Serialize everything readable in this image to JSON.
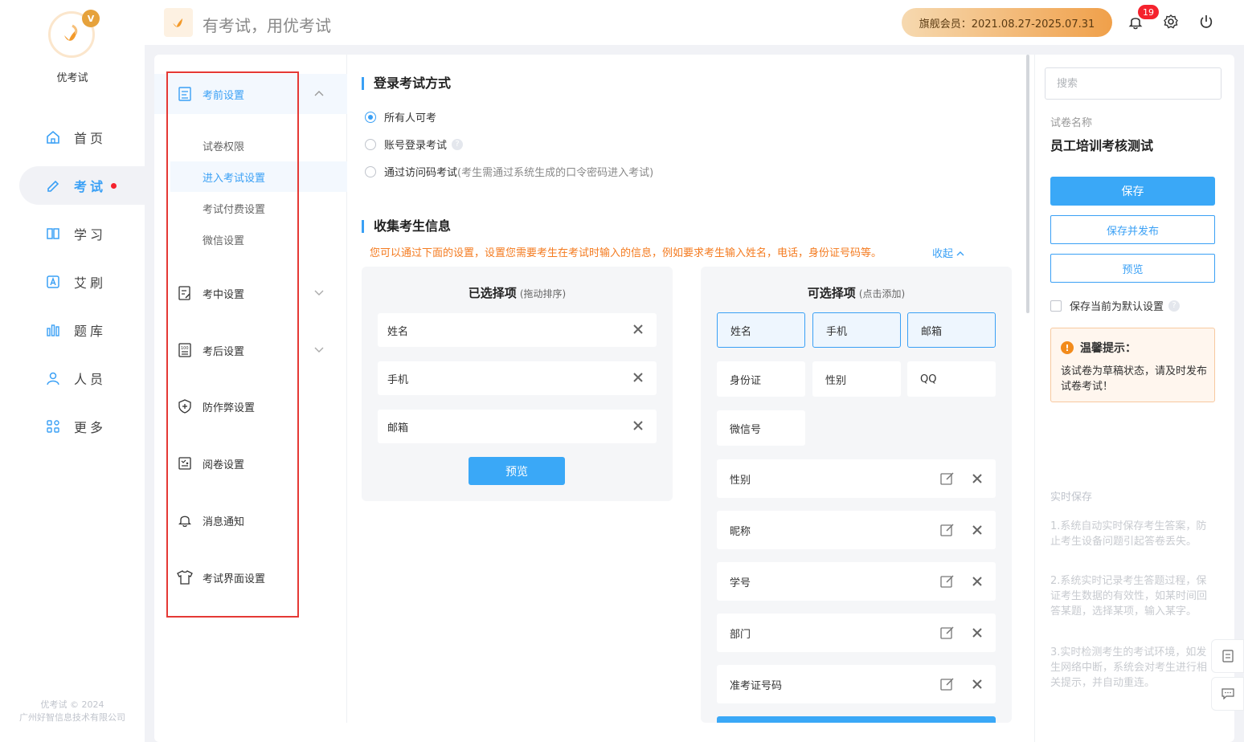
{
  "app": {
    "logo_text": "优考试",
    "logo_badge": "V",
    "slogan": "有考试，用优考试",
    "copyright_line1": "优考试 © 2024",
    "copyright_line2": "广州好智信息技术有限公司",
    "accent_color": "#3aa0f5"
  },
  "nav": {
    "items": [
      {
        "label": "首页",
        "icon": "home-icon"
      },
      {
        "label": "考试",
        "icon": "pencil-icon",
        "active": true
      },
      {
        "label": "学习",
        "icon": "book-icon"
      },
      {
        "label": "艾刷",
        "icon": "letter-a-icon"
      },
      {
        "label": "题库",
        "icon": "bars-icon"
      },
      {
        "label": "人员",
        "icon": "user-icon"
      },
      {
        "label": "更多",
        "icon": "grid-icon"
      }
    ]
  },
  "topbar": {
    "vip_label": "旗舰会员：2021.08.27-2025.07.31",
    "notification_count": "19"
  },
  "settings_menu": {
    "group_label": "考前设置",
    "sub_items": [
      "试卷权限",
      "进入考试设置",
      "考试付费设置",
      "微信设置"
    ],
    "active_sub": "进入考试设置",
    "items": [
      {
        "label": "考中设置",
        "icon": "edit-doc-icon",
        "expandable": true
      },
      {
        "label": "考后设置",
        "icon": "report-icon",
        "expandable": true
      },
      {
        "label": "防作弊设置",
        "icon": "shield-icon"
      },
      {
        "label": "阅卷设置",
        "icon": "grading-icon"
      },
      {
        "label": "消息通知",
        "icon": "bell-icon"
      },
      {
        "label": "考试界面设置",
        "icon": "shirt-icon"
      }
    ]
  },
  "login": {
    "title": "登录考试方式",
    "options": [
      {
        "label": "所有人可考",
        "selected": true
      },
      {
        "label": "账号登录考试",
        "selected": false
      },
      {
        "label": "通过访问码考试",
        "hint": "(考生需通过系统生成的口令密码进入考试)",
        "selected": false
      }
    ]
  },
  "collect": {
    "title": "收集考生信息",
    "warning": "您可以通过下面的设置，设置您需要考生在考试时输入的信息，例如要求考生输入姓名，电话，身份证号码等。",
    "collapse": "收起",
    "selected_panel": {
      "title": "已选择项",
      "subtitle": "(拖动排序)",
      "items": [
        "姓名",
        "手机",
        "邮箱"
      ],
      "preview_button": "预览"
    },
    "available_panel": {
      "title": "可选择项",
      "subtitle": "(点击添加)",
      "chips": [
        "姓名",
        "手机",
        "邮箱",
        "身份证",
        "性别",
        "QQ",
        "微信号"
      ],
      "custom_rows": [
        "性别",
        "昵称",
        "学号",
        "部门",
        "准考证号码"
      ]
    }
  },
  "right": {
    "search_placeholder": "搜索",
    "paper_name_label": "试卷名称",
    "paper_name": "员工培训考核测试",
    "save": "保存",
    "save_publish": "保存并发布",
    "preview": "预览",
    "default_setting": "保存当前为默认设置",
    "tip_title": "温馨提示：",
    "tip_body": "该试卷为草稿状态，请及时发布试卷考试！",
    "realtime_title": "实时保存",
    "realtime_p1": "1.系统自动实时保存考生答案，防止考生设备问题引起答卷丢失。",
    "realtime_p2": "2.系统实时记录考生答题过程，保证考生数据的有效性，如某时间回答某题，选择某项，输入某字。",
    "realtime_p3": "3.实时检测考生的考试环境，如发生网络中断，系统会对考生进行相关提示，并自动重连。"
  }
}
